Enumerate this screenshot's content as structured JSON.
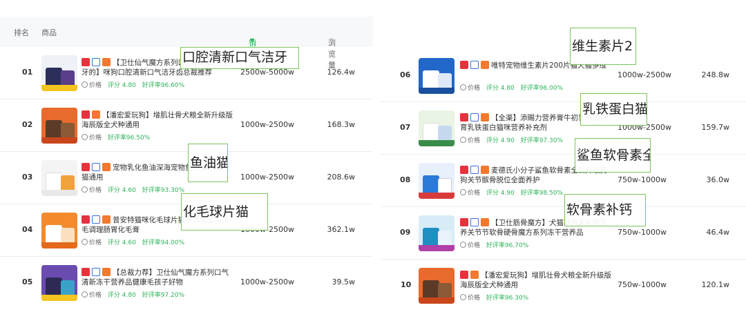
{
  "header": {
    "rank": "排名",
    "goods": "商品",
    "sales": "销售额",
    "views": "浏览量"
  },
  "meta": {
    "price_label": "价格",
    "score_prefix": "评分",
    "rate_prefix": "好评率"
  },
  "left_rows": [
    {
      "rank": "01",
      "title": "【卫仕仙气魔方系列口腔清新口气洁牙的】咪狗口腔清新口气洁牙齿总裁推荐",
      "score": "4.80",
      "rate": "96.60%",
      "sales": "2500w-5000w",
      "views": "126.4w"
    },
    {
      "rank": "02",
      "title": "【潘宏爱玩狗】增肌壮骨犬粮全新升级版海辰版全犬种通用",
      "score": "",
      "rate": "96.50%",
      "sales": "1000w-2500w",
      "views": "168.3w"
    },
    {
      "rank": "03",
      "title": "宠物乳化鱼油深海宠物鱼油猫咪用犬猫通用",
      "score": "4.60",
      "rate": "93.30%",
      "sales": "1000w-2500w",
      "views": "208.6w"
    },
    {
      "rank": "04",
      "title": "普安特猫咪化毛球片猫咪消化温和排毛调理肠胃化毛膏",
      "score": "4.60",
      "rate": "94.00%",
      "sales": "1000w-2500w",
      "views": "362.1w"
    },
    {
      "rank": "05",
      "title": "【总裁力荐】卫仕仙气魔方系列口气清新冻干营养品健康毛孩子好物",
      "score": "4.80",
      "rate": "97.20%",
      "sales": "1000w-2500w",
      "views": "39.5w"
    }
  ],
  "right_rows": [
    {
      "rank": "06",
      "title": "唯特宠物维生素片200片猫犬猫多维",
      "score": "4.80",
      "rate": "96.00%",
      "sales": "1000w-2500w",
      "views": "248.8w"
    },
    {
      "rank": "07",
      "title": "【全渠】添賜力营养膏牛初乳铁蛋白育乳铁蛋白猫咪营养补充剂",
      "score": "4.90",
      "rate": "97.30%",
      "sales": "1000w-2500w",
      "views": "159.7w"
    },
    {
      "rank": "08",
      "title": "麦德氏小分子鲨鱼软骨素全新升级狗狗关节髌骨脱位全面养护",
      "score": "4.90",
      "rate": "98.50%",
      "sales": "750w-1000w",
      "views": "36.0w"
    },
    {
      "rank": "09",
      "title": "【卫仕筋骨魔方】犬猫软骨素补钙营养关节节软骨硬骨魔方系列冻干营养品",
      "score": "",
      "rate": "96.70%",
      "sales": "750w-1000w",
      "views": "46.4w"
    },
    {
      "rank": "10",
      "title": "【潘宏爱玩狗】增肌壮骨犬粮全新升级版海辰版全犬种通用",
      "score": "",
      "rate": "96.30%",
      "sales": "750w-1000w",
      "views": "120.1w"
    }
  ],
  "overlays": {
    "o1": "口腔清新口气洁牙",
    "o2": "鱼油猫",
    "o3": "化毛球片猫",
    "o4": "维生素片2",
    "o5": "乳铁蛋白猫",
    "o6": "鲨鱼软骨素全",
    "o7": "软骨素补钙"
  },
  "colors": {
    "accent_green": "#2fb35b",
    "tag_red": "#e5333d",
    "tag_blue": "#3b6fe0",
    "tag_orange": "#f2792f"
  }
}
